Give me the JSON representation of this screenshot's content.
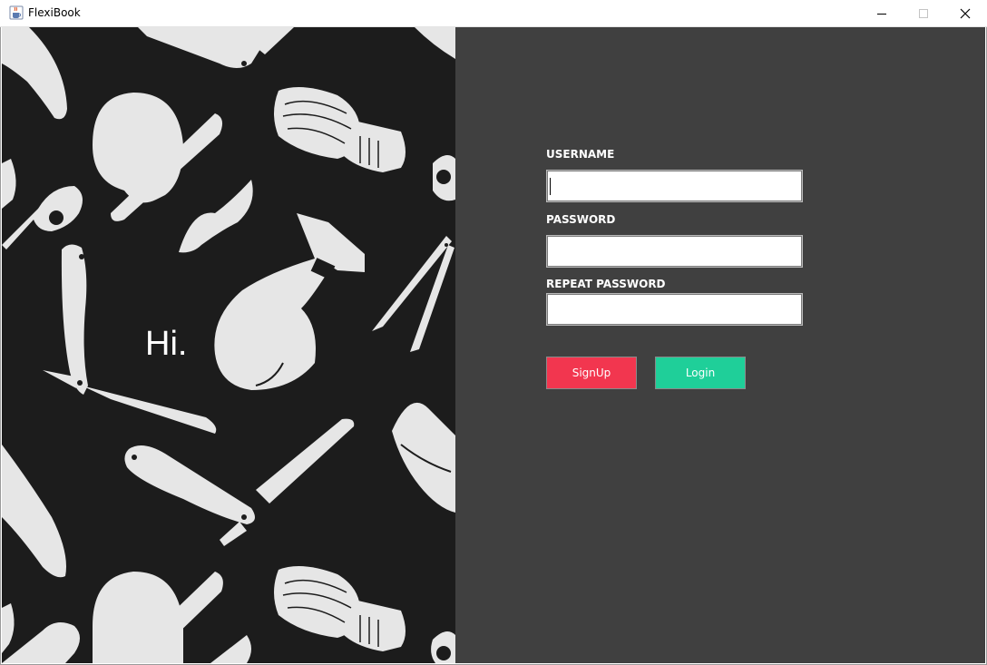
{
  "window": {
    "title": "FlexiBook",
    "icon": "java-cup-icon"
  },
  "left_panel": {
    "greeting": "Hi."
  },
  "form": {
    "username_label": "USERNAME",
    "username_value": "",
    "password_label": "PASSWORD",
    "password_value": "",
    "repeat_password_label": "REPEAT PASSWORD",
    "repeat_password_value": ""
  },
  "buttons": {
    "signup_label": "SignUp",
    "login_label": "Login"
  },
  "colors": {
    "left_background": "#1c1c1c",
    "right_background": "#404040",
    "signup": "#f2364f",
    "login": "#1fcf99",
    "illustration": "#e6e6e6"
  }
}
